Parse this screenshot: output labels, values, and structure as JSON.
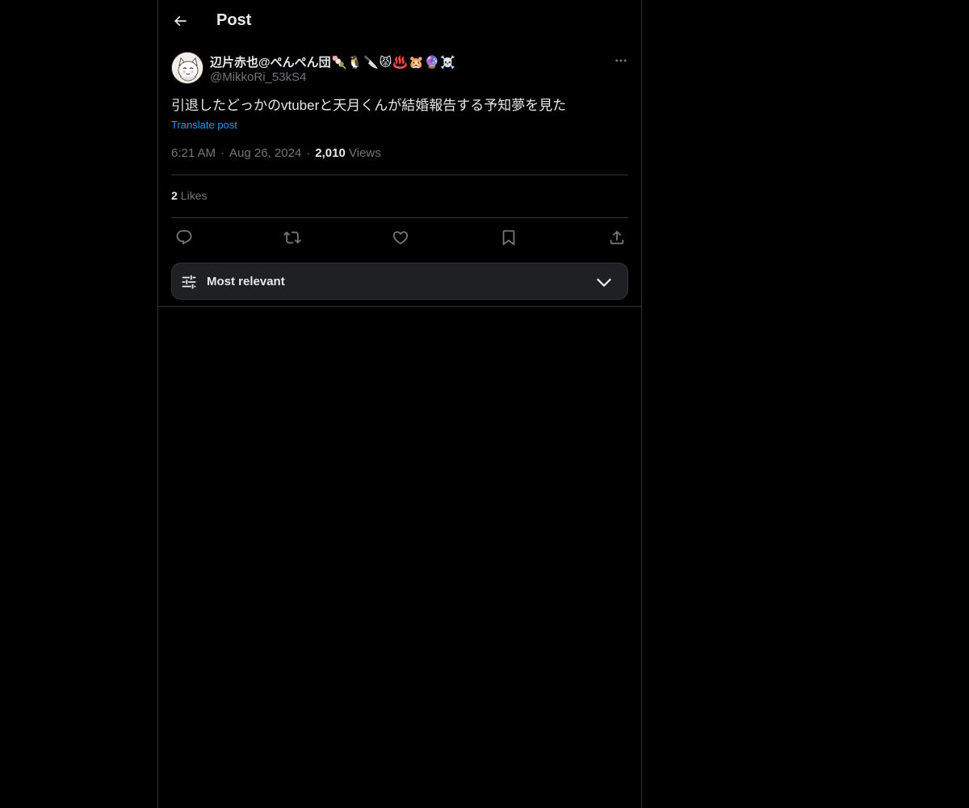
{
  "header": {
    "title": "Post",
    "back_icon": "arrow-left-icon"
  },
  "post": {
    "author": {
      "name": "辺片赤也@ぺんぺん団",
      "emojis": "🍡🐧🔪😾♨️🐹🔮☠️",
      "handle": "@MikkoRi_53kS4",
      "avatar_icon": "avatar-cat-drawing"
    },
    "text": "引退したどっかのvtuberと天月くんが結婚報告する予知夢を見た",
    "translate_label": "Translate post",
    "time": "6:21 AM",
    "date": "Aug 26, 2024",
    "views_count": "2,010",
    "views_label": "Views",
    "likes_count": "2",
    "likes_label": "Likes"
  },
  "actions": [
    {
      "name": "reply",
      "icon": "reply-icon"
    },
    {
      "name": "repost",
      "icon": "repost-icon"
    },
    {
      "name": "like",
      "icon": "heart-icon"
    },
    {
      "name": "bookmark",
      "icon": "bookmark-icon"
    },
    {
      "name": "share",
      "icon": "share-icon"
    }
  ],
  "sort": {
    "label": "Most relevant",
    "icon": "sliders-icon",
    "chevron_icon": "chevron-down-icon"
  },
  "colors": {
    "background": "#000000",
    "text": "#e7e9ea",
    "secondary": "#71767b",
    "accent": "#1d9bf0",
    "border": "#2f3336"
  }
}
